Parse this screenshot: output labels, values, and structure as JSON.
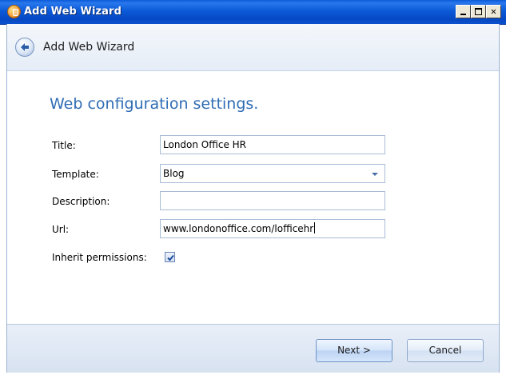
{
  "window": {
    "title": "Add Web Wizard"
  },
  "header": {
    "title": "Add Web Wizard"
  },
  "main": {
    "section_title": "Web configuration settings.",
    "fields": {
      "title": {
        "label": "Title:",
        "value": "London Office HR"
      },
      "template": {
        "label": "Template:",
        "value": "Blog"
      },
      "description": {
        "label": "Description:",
        "value": ""
      },
      "url": {
        "label": "Url:",
        "value": "www.londonoffice.com/lofficehr"
      },
      "inherit": {
        "label": "Inherit permissions:",
        "checked": true
      }
    }
  },
  "footer": {
    "next_label": "Next >",
    "cancel_label": "Cancel"
  },
  "icons": {
    "app": "app-icon",
    "back": "back-arrow-icon",
    "dropdown": "chevron-down-icon",
    "check": "checkmark-icon"
  },
  "colors": {
    "titlebar": "#0b5ad8",
    "section_title": "#2f6db5",
    "footer": "#dfe8f5"
  }
}
